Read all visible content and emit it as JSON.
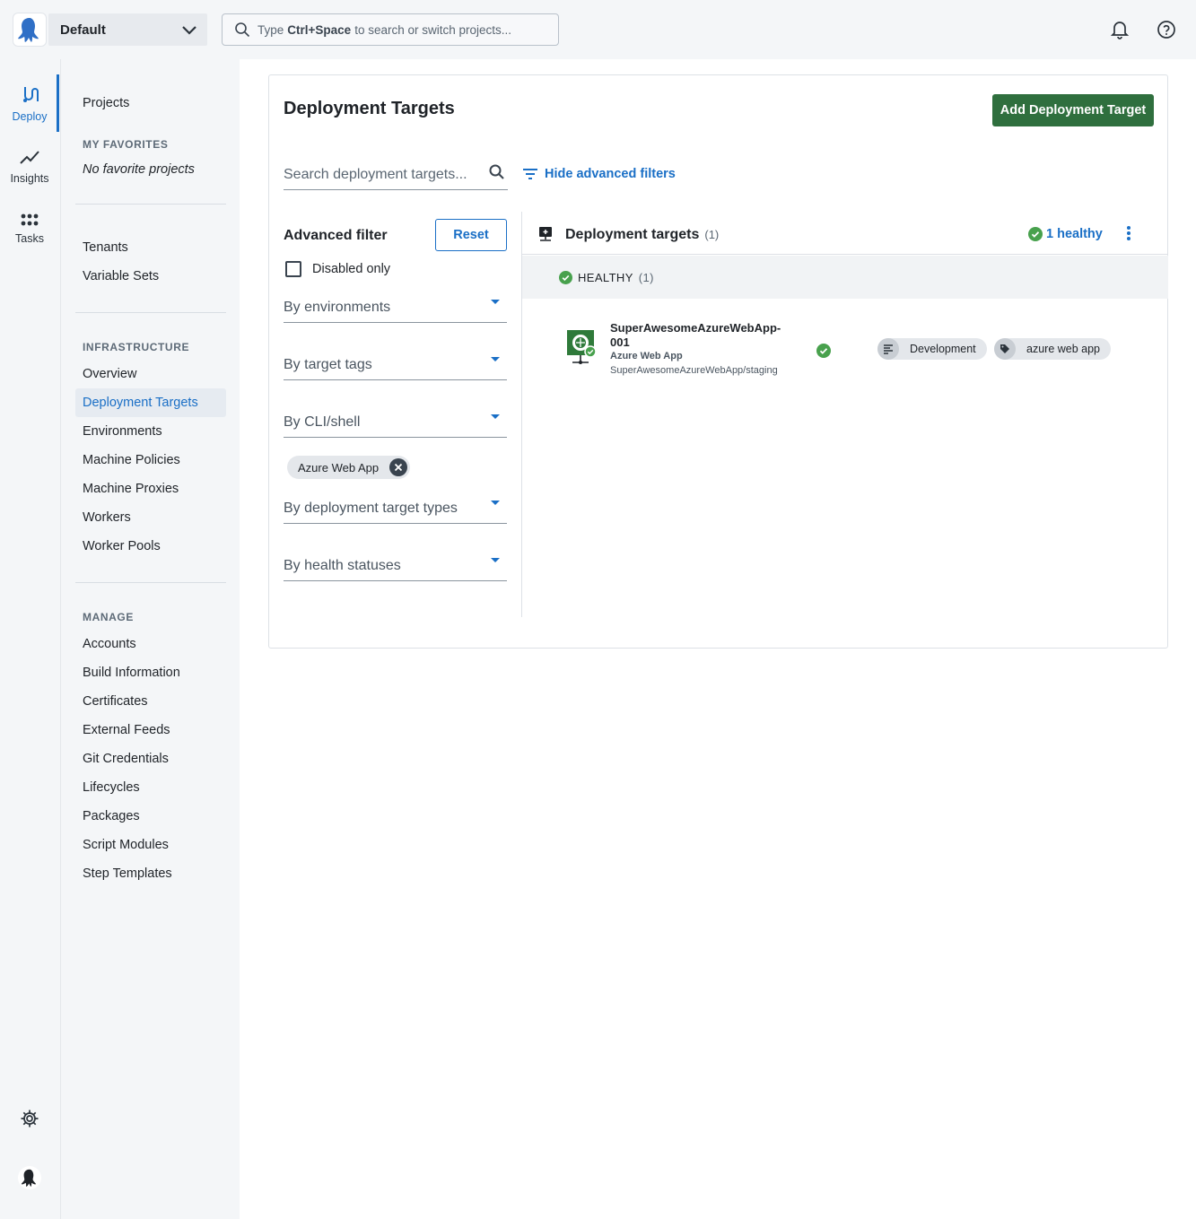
{
  "header": {
    "space_name": "Default",
    "search_prefix": "Type",
    "search_shortcut": "Ctrl+Space",
    "search_suffix": "to search or switch projects..."
  },
  "rail": {
    "items": [
      {
        "label": "Deploy",
        "icon": "deploy-icon"
      },
      {
        "label": "Insights",
        "icon": "chart-line-icon"
      },
      {
        "label": "Tasks",
        "icon": "grid-dots-icon"
      }
    ]
  },
  "subnav": {
    "projects": "Projects",
    "favorites_heading": "MY FAVORITES",
    "favorites_empty": "No favorite projects",
    "tenants": "Tenants",
    "variable_sets": "Variable Sets",
    "infrastructure_heading": "INFRASTRUCTURE",
    "infrastructure": [
      "Overview",
      "Deployment Targets",
      "Environments",
      "Machine Policies",
      "Machine Proxies",
      "Workers",
      "Worker Pools"
    ],
    "manage_heading": "MANAGE",
    "manage": [
      "Accounts",
      "Build Information",
      "Certificates",
      "External Feeds",
      "Git Credentials",
      "Lifecycles",
      "Packages",
      "Script Modules",
      "Step Templates"
    ]
  },
  "page": {
    "title": "Deployment Targets",
    "add_button": "Add Deployment Target",
    "search_placeholder": "Search deployment targets...",
    "hide_filters": "Hide advanced filters"
  },
  "filters": {
    "title": "Advanced filter",
    "reset": "Reset",
    "disabled_only": "Disabled only",
    "by_environments": "By environments",
    "by_target_tags": "By target tags",
    "by_cli_shell": "By CLI/shell",
    "selected_chip": "Azure Web App",
    "by_target_types": "By deployment target types",
    "by_health": "By health statuses"
  },
  "results": {
    "title": "Deployment targets",
    "count": "(1)",
    "healthy_summary": "1 healthy",
    "group_label": "HEALTHY",
    "group_count": "(1)",
    "target": {
      "name": "SuperAwesomeAzureWebApp-001",
      "type": "Azure Web App",
      "path": "SuperAwesomeAzureWebApp/staging",
      "environment": "Development",
      "tag": "azure web app"
    }
  },
  "colors": {
    "accent": "#1a6fc6",
    "primary_button": "#2f6f3e",
    "healthy": "#48a14d"
  }
}
